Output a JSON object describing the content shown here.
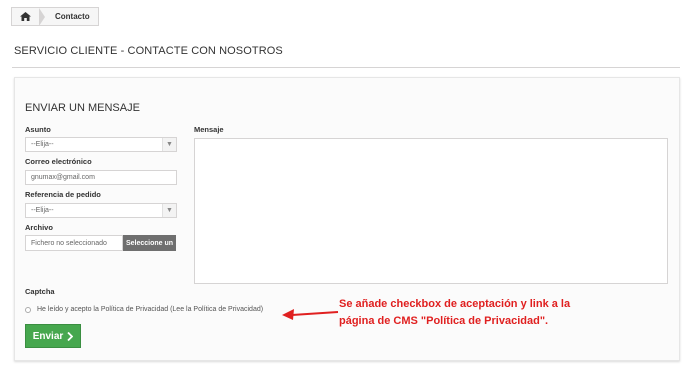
{
  "breadcrumb": {
    "home_icon": "home-icon",
    "current": "Contacto"
  },
  "page_title": "SERVICIO CLIENTE - CONTACTE CON NOSOTROS",
  "form": {
    "section_title": "ENVIAR UN MENSAJE",
    "subject_label": "Asunto",
    "subject_value": "--Elija--",
    "email_label": "Correo electrónico",
    "email_placeholder": "gnumax@gmail.com",
    "order_label": "Referencia de pedido",
    "order_value": "--Elija--",
    "file_label": "Archivo",
    "file_name": "Fichero no seleccionado",
    "file_button": "Seleccione un",
    "message_label": "Mensaje",
    "captcha_label": "Captcha",
    "privacy_text": "He leído y acepto la Política de Privacidad (Lee la Política de Privacidad)",
    "submit_label": "Enviar",
    "submit_icon": "chevron-right-icon"
  },
  "annotation": {
    "line1": "Se añade checkbox de aceptación y link a la",
    "line2": "página de CMS \"Política de Privacidad\".",
    "color": "#e02020"
  },
  "colors": {
    "submit_green": "#46a74e",
    "file_button_gray": "#6f6f6f"
  }
}
